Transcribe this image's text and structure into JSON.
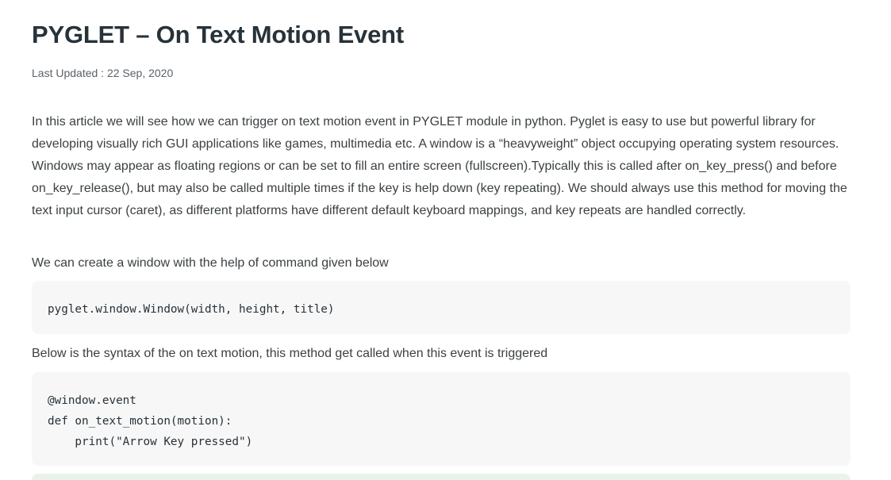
{
  "article": {
    "title": "PYGLET – On Text Motion Event",
    "last_updated": "Last Updated : 22 Sep, 2020",
    "intro": "In this article we will see how we can trigger on text motion event in PYGLET module in python. Pyglet is easy to use but powerful library for developing visually rich GUI applications like games, multimedia etc. A window is a “heavyweight” object occupying operating system resources. Windows may appear as floating regions or can be set to fill an entire screen (fullscreen).Typically this is called after on_key_press() and before on_key_release(), but may also be called multiple times if the key is help down (key repeating). We should always use this method for moving the text input cursor (caret), as different platforms have different default keyboard mappings, and key repeats are handled correctly.",
    "create_window_text": "We can create a window with the help of command given below",
    "create_window_code": [
      "pyglet.window.Window(width, height, title)"
    ],
    "syntax_text": "Below is the syntax of the on text motion, this method get called when this event is triggered",
    "syntax_code": [
      "@window.event",
      "def on_text_motion(motion):",
      "    print(\"Arrow Key pressed\")"
    ]
  }
}
